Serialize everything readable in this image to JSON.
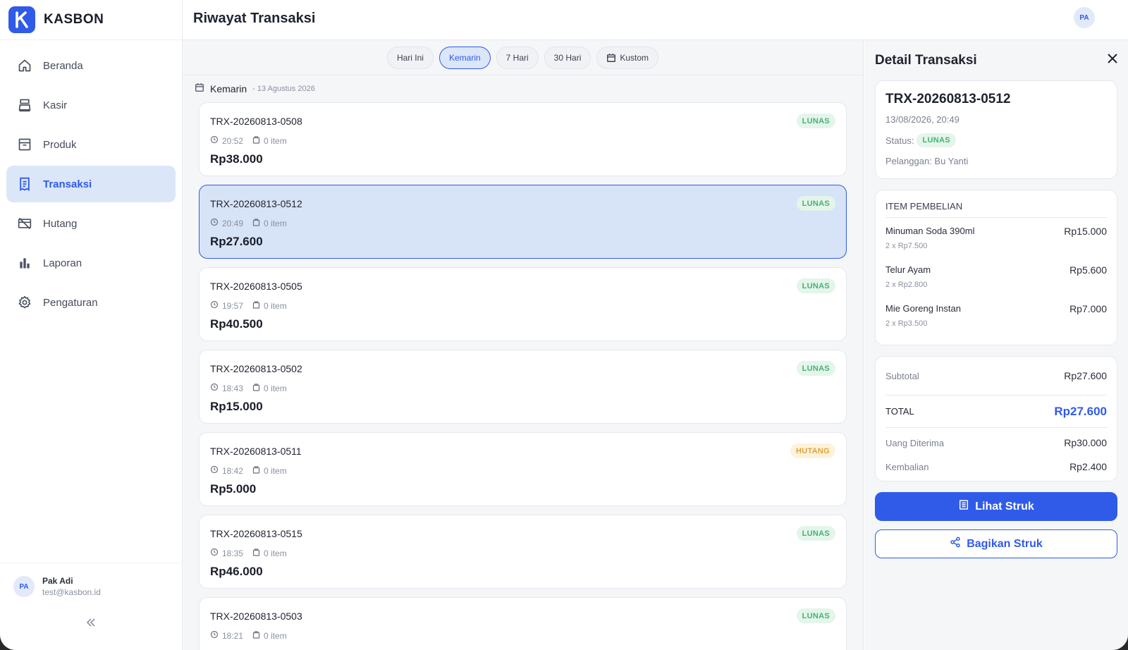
{
  "brand": {
    "name": "KASBON",
    "logo_letter": "K",
    "accent": "#2f5be8"
  },
  "sidebar": {
    "items": [
      {
        "label": "Beranda",
        "icon": "home-icon"
      },
      {
        "label": "Kasir",
        "icon": "cash-register-icon"
      },
      {
        "label": "Produk",
        "icon": "archive-box-icon"
      },
      {
        "label": "Transaksi",
        "icon": "receipt-icon",
        "active": true
      },
      {
        "label": "Hutang",
        "icon": "credit-card-off-icon"
      },
      {
        "label": "Laporan",
        "icon": "bar-chart-icon"
      },
      {
        "label": "Pengaturan",
        "icon": "gear-icon"
      }
    ],
    "user": {
      "initials": "PA",
      "name": "Pak Adi",
      "email": "test@kasbon.id"
    },
    "collapse_icon": "double-chevron-left-icon"
  },
  "header": {
    "title": "Riwayat Transaksi",
    "avatar_initials": "PA"
  },
  "filters": {
    "chips": [
      "Hari Ini",
      "Kemarin",
      "7 Hari",
      "30 Hari",
      "Kustom"
    ],
    "active": "Kemarin"
  },
  "date_group": {
    "label": "Kemarin",
    "sub": "- 13 Agustus 2026"
  },
  "transactions": [
    {
      "id": "TRX-20260813-0508",
      "time": "20:52",
      "items": "0 item",
      "amount": "Rp38.000",
      "status": "LUNAS"
    },
    {
      "id": "TRX-20260813-0512",
      "time": "20:49",
      "items": "0 item",
      "amount": "Rp27.600",
      "status": "LUNAS",
      "selected": true
    },
    {
      "id": "TRX-20260813-0505",
      "time": "19:57",
      "items": "0 item",
      "amount": "Rp40.500",
      "status": "LUNAS"
    },
    {
      "id": "TRX-20260813-0502",
      "time": "18:43",
      "items": "0 item",
      "amount": "Rp15.000",
      "status": "LUNAS"
    },
    {
      "id": "TRX-20260813-0511",
      "time": "18:42",
      "items": "0 item",
      "amount": "Rp5.000",
      "status": "HUTANG"
    },
    {
      "id": "TRX-20260813-0515",
      "time": "18:35",
      "items": "0 item",
      "amount": "Rp46.000",
      "status": "LUNAS"
    },
    {
      "id": "TRX-20260813-0503",
      "time": "18:21",
      "items": "0 item",
      "amount": "",
      "status": "LUNAS"
    }
  ],
  "detail": {
    "title": "Detail Transaksi",
    "id": "TRX-20260813-0512",
    "datetime": "13/08/2026, 20:49",
    "status_label": "Status:",
    "status": "LUNAS",
    "customer": "Pelanggan: Bu Yanti",
    "items_title": "ITEM PEMBELIAN",
    "items": [
      {
        "name": "Minuman Soda 390ml",
        "qty": "2 x Rp7.500",
        "price": "Rp15.000"
      },
      {
        "name": "Telur Ayam",
        "qty": "2 x Rp2.800",
        "price": "Rp5.600"
      },
      {
        "name": "Mie Goreng Instan",
        "qty": "2 x Rp3.500",
        "price": "Rp7.000"
      }
    ],
    "subtotal_label": "Subtotal",
    "subtotal": "Rp27.600",
    "total_label": "TOTAL",
    "total": "Rp27.600",
    "received_label": "Uang Diterima",
    "received": "Rp30.000",
    "change_label": "Kembalian",
    "change": "Rp2.400",
    "btn_view": "Lihat Struk",
    "btn_share": "Bagikan Struk"
  }
}
